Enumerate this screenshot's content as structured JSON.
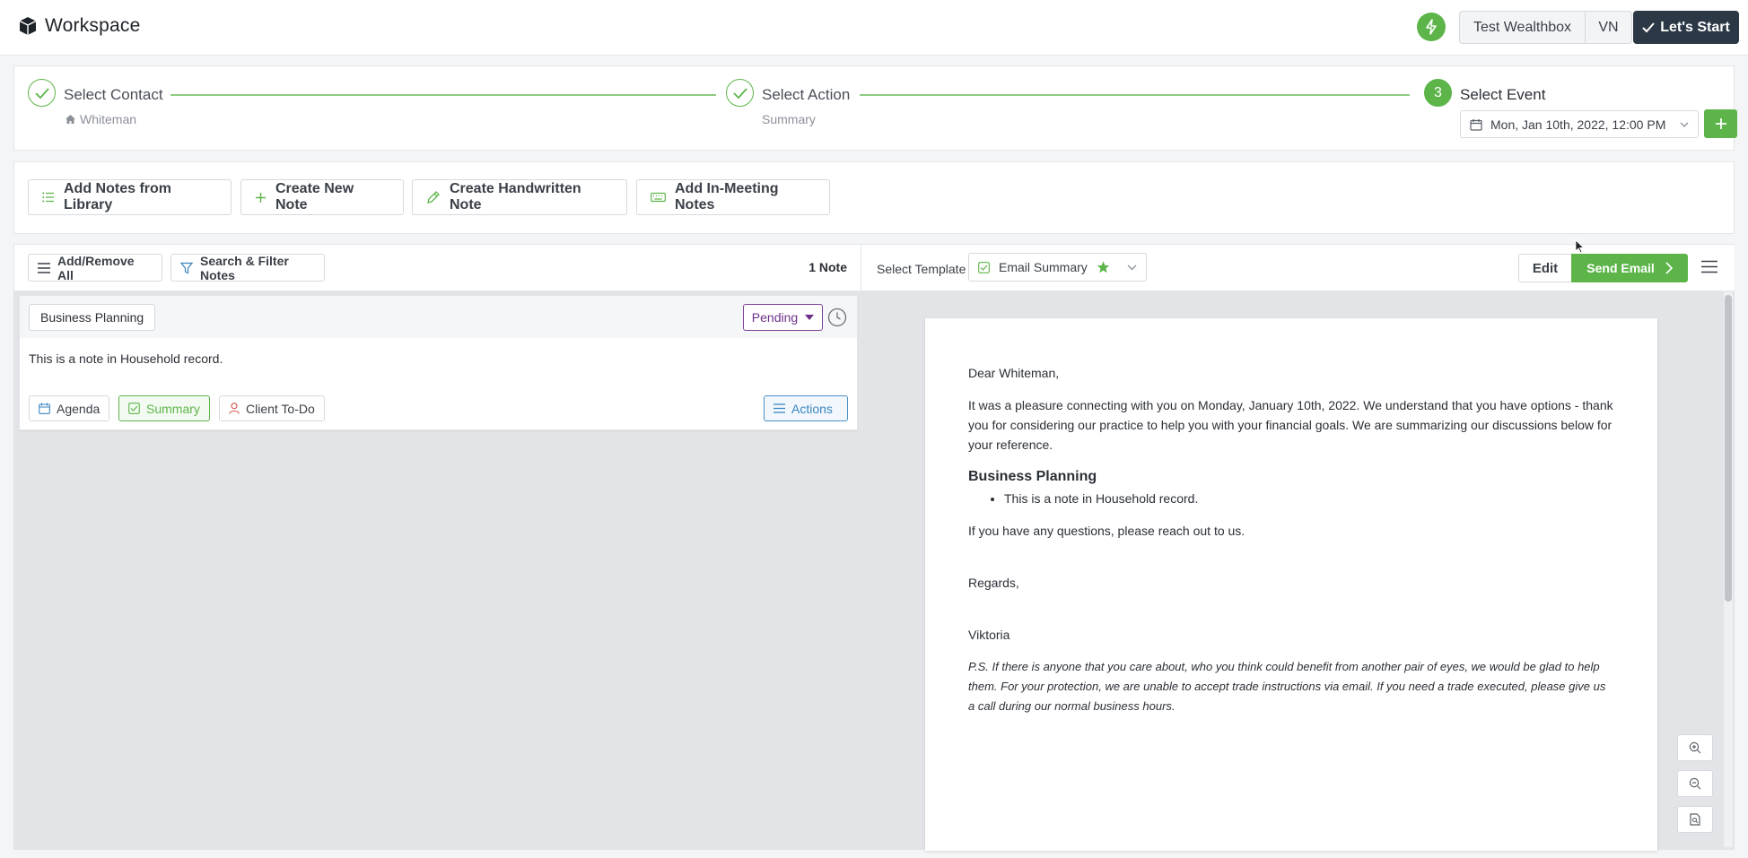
{
  "header": {
    "app_title": "Workspace",
    "account_name": "Test Wealthbox",
    "user_initials": "VN",
    "start_label": "Let's Start",
    "icons": {
      "logo": "cube-icon",
      "quick_action": "bolt-icon",
      "start": "check-icon"
    }
  },
  "stepper": {
    "steps": [
      {
        "title": "Select Contact",
        "subtitle": "Whiteman",
        "state": "complete"
      },
      {
        "title": "Select Action",
        "subtitle": "Summary",
        "state": "complete"
      },
      {
        "title": "Select Event",
        "number": "3",
        "state": "active"
      }
    ],
    "event_datetime": "Mon, Jan 10th, 2022, 12:00 PM",
    "accent_color": "#5db54a"
  },
  "toolbar": {
    "add_library": "Add Notes from Library",
    "create_new": "Create New Note",
    "create_handwritten": "Create Handwritten Note",
    "add_in_meeting": "Add In-Meeting Notes"
  },
  "notes_panel": {
    "add_remove_all": "Add/Remove All",
    "search_filter": "Search & Filter Notes",
    "count_label": "1 Note",
    "notes": [
      {
        "category": "Business Planning",
        "status": "Pending",
        "body": "This is a note in Household record.",
        "chips": {
          "agenda": "Agenda",
          "summary": "Summary",
          "todo": "Client To-Do"
        },
        "actions_label": "Actions"
      }
    ]
  },
  "preview": {
    "select_template_label": "Select Template",
    "template_name": "Email Summary",
    "edit_label": "Edit",
    "send_label": "Send Email",
    "email": {
      "greeting": "Dear Whiteman,",
      "intro": "It was a pleasure connecting with you on Monday, January 10th, 2022. We understand that you have options - thank you for considering our practice to help you with your financial goals. We are summarizing our discussions below for your reference.",
      "section_title": "Business Planning",
      "section_item": "This is a note in Household record.",
      "questions": "If you have any questions, please reach out to us.",
      "regards": "Regards,",
      "signature": "Viktoria",
      "ps": "P.S. If there is anyone that you care about, who you think could benefit from another pair of eyes, we would be glad to help them. For your protection, we are unable to accept trade instructions via email. If you need a trade executed, please give us a call during our normal business hours."
    }
  }
}
